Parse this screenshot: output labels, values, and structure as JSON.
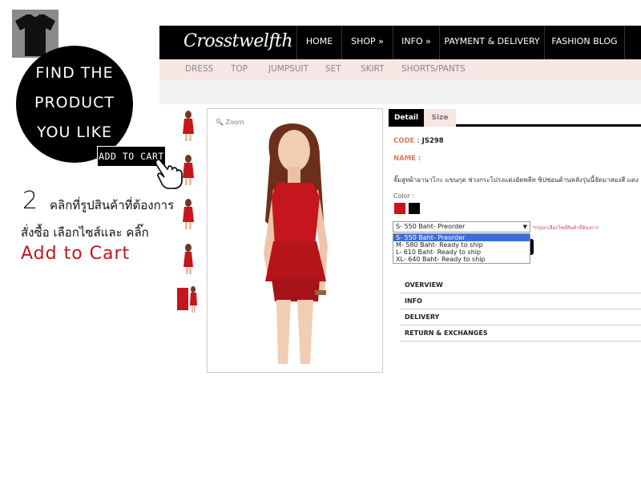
{
  "tutorial": {
    "circle_lines": [
      "FIND THE",
      "PRODUCT",
      "YOU LIKE"
    ],
    "tag": "ADD TO CART",
    "step_number": "2",
    "step_line1": "คลิกที่รูปสินค้าที่ต้องการ",
    "step_line2": "สั่งซื้อ เลือกไซส์และ คลิ๊ก",
    "step_line3": "Add to Cart"
  },
  "header": {
    "logo": "Crosstwelfth",
    "nav": [
      "HOME",
      "SHOP »",
      "INFO »",
      "PAYMENT & DELIVERY",
      "FASHION BLOG"
    ],
    "subnav": [
      "DRESS",
      "TOP",
      "JUMPSUIT",
      "SET",
      "SKIRT",
      "SHORTS/PANTS"
    ]
  },
  "product": {
    "zoom_label": "Zoom",
    "tabs": [
      "Detail",
      "Size"
    ],
    "code_label": "CODE :",
    "code_value": "JS298",
    "name_label": "NAME :",
    "description": "จั๊มสูทผ้าอานาโกะ แขนกุด ช่วงกระโปรงแต่งอัดพลีท ซิปซ่อนด้านหลังรุ่นนี้จัดมาสองสี แดง",
    "color_label": "Color :",
    "colors": [
      "#c4161c",
      "#000000"
    ],
    "size_selected": "S- 550 Baht- Preorder",
    "size_hint": "*กรุณาเลือกไซส์สินค้าที่ต้องการ",
    "size_options": [
      "S- 550 Baht- Preorder",
      "M- 580 Baht- Ready to ship",
      "L- 610 Baht- Ready to ship",
      "XL- 640 Baht- Ready to ship"
    ],
    "accordion": [
      "OVERVIEW",
      "INFO",
      "DELIVERY",
      "RETURN & EXCHANGES"
    ]
  }
}
